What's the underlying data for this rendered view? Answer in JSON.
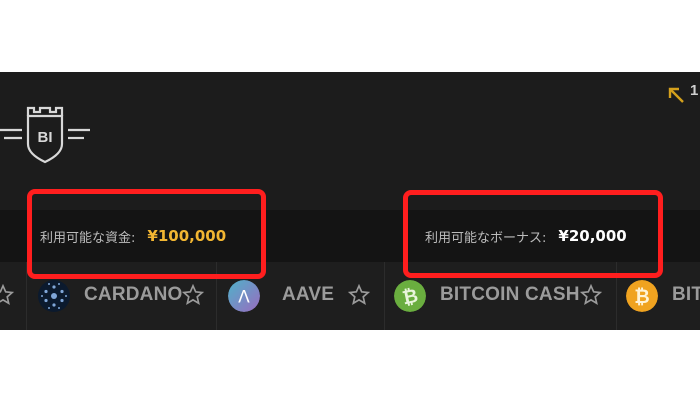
{
  "header": {
    "logo_icon": "castle-bi-logo",
    "logo_text": "BI",
    "corner_icon": "arrow-up-left-icon",
    "corner_text": "1"
  },
  "balances": {
    "funds": {
      "label": "利用可能な資金:",
      "value": "¥100,000",
      "color": "#f2b632"
    },
    "bonus": {
      "label": "利用可能なボーナス:",
      "value": "¥20,000",
      "color": "#ffffff"
    }
  },
  "coins": [
    {
      "name": "CARDANO",
      "icon": "cardano-icon"
    },
    {
      "name": "AAVE",
      "icon": "aave-icon",
      "icon_text": "Λ"
    },
    {
      "name": "BITCOIN CASH",
      "icon": "bitcoin-cash-icon",
      "icon_text": "₿"
    },
    {
      "name": "BIT",
      "icon": "bitcoin-icon",
      "icon_text": "₿"
    }
  ],
  "highlight_color": "#ff1e1e"
}
